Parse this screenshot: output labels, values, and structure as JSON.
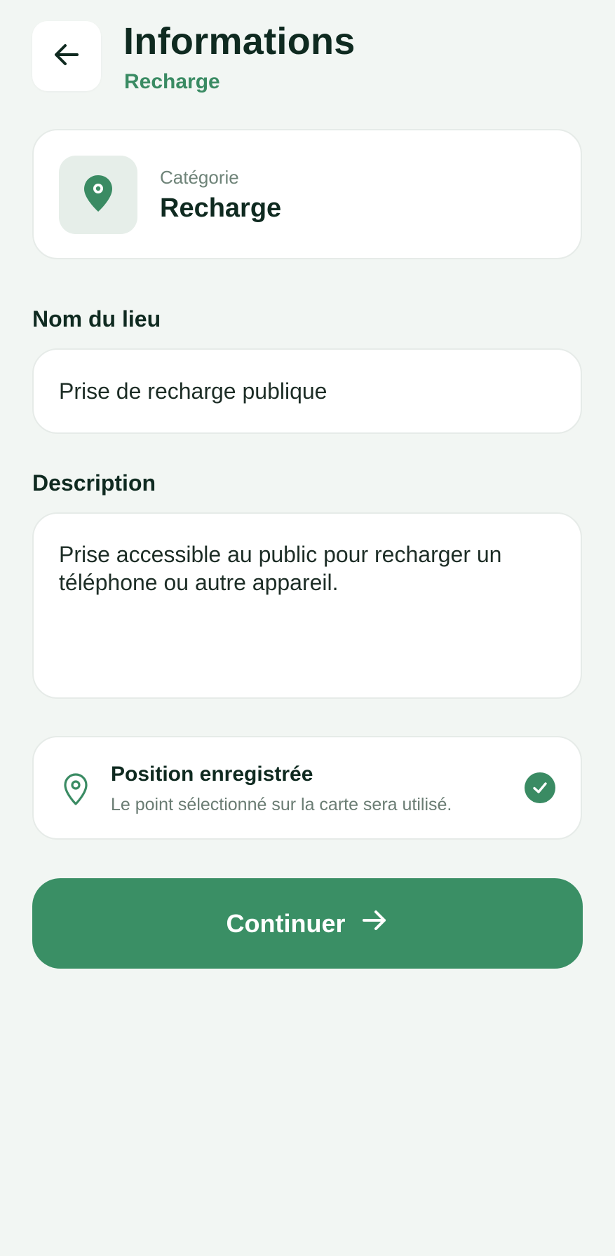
{
  "header": {
    "title": "Informations",
    "subtitle": "Recharge",
    "back_icon": "arrow-left-icon"
  },
  "category": {
    "label": "Catégorie",
    "value": "Recharge",
    "icon": "map-pin-icon"
  },
  "form": {
    "name_label": "Nom du lieu",
    "name_value": "Prise de recharge publique",
    "description_label": "Description",
    "description_value": "Prise accessible au public pour recharger un téléphone ou autre appareil."
  },
  "position": {
    "title": "Position enregistrée",
    "description": "Le point sélectionné sur la carte sera utilisé.",
    "icon": "map-pin-outline-icon",
    "status_icon": "check-circle-icon"
  },
  "actions": {
    "continue_label": "Continuer",
    "continue_icon": "arrow-right-icon"
  },
  "colors": {
    "background": "#f2f6f3",
    "accent": "#3a8f65",
    "text": "#0f2a20",
    "muted": "#6e8378"
  }
}
